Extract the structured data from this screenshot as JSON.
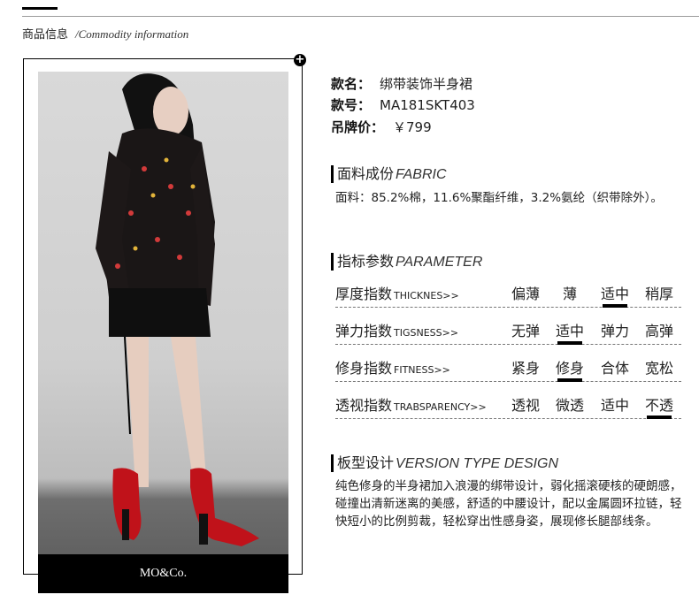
{
  "header": {
    "title_cn": "商品信息",
    "title_en": "/Commodity information"
  },
  "product": {
    "name_label": "款名：",
    "name": "绑带装饰半身裙",
    "code_label": "款号：",
    "code": "MA181SKT403",
    "price_label": "吊牌价：",
    "price": "￥799"
  },
  "image": {
    "brand": "MO&Co."
  },
  "fabric": {
    "title_cn": "面料成份",
    "title_en": "FABRIC",
    "text": "面料：85.2%棉，11.6%聚酯纤维，3.2%氨纶（织带除外）。"
  },
  "parameter": {
    "title_cn": "指标参数",
    "title_en": "PARAMETER",
    "rows": [
      {
        "label_cn": "厚度指数",
        "label_en": "THICKNES>>",
        "options": [
          "偏薄",
          "薄",
          "适中",
          "稍厚"
        ],
        "selected": 2
      },
      {
        "label_cn": "弹力指数",
        "label_en": "TIGSNESS>>",
        "options": [
          "无弹",
          "适中",
          "弹力",
          "高弹"
        ],
        "selected": 1
      },
      {
        "label_cn": "修身指数",
        "label_en": "FITNESS>>",
        "options": [
          "紧身",
          "修身",
          "合体",
          "宽松"
        ],
        "selected": 1
      },
      {
        "label_cn": "透视指数",
        "label_en": "TRABSPARENCY>>",
        "options": [
          "透视",
          "微透",
          "适中",
          "不透"
        ],
        "selected": 3
      }
    ]
  },
  "design": {
    "title_cn": "板型设计",
    "title_en": "VERSION TYPE DESIGN",
    "text": "纯色修身的半身裙加入浪漫的绑带设计，弱化摇滚硬核的硬朗感，碰撞出清新迷离的美感，舒适的中腰设计，配以金属圆环拉链，轻快短小的比例剪裁，轻松穿出性感身姿，展现修长腿部线条。"
  },
  "colors": {
    "accent": "#000000",
    "boots": "#c0121a",
    "background": "#ffffff"
  }
}
